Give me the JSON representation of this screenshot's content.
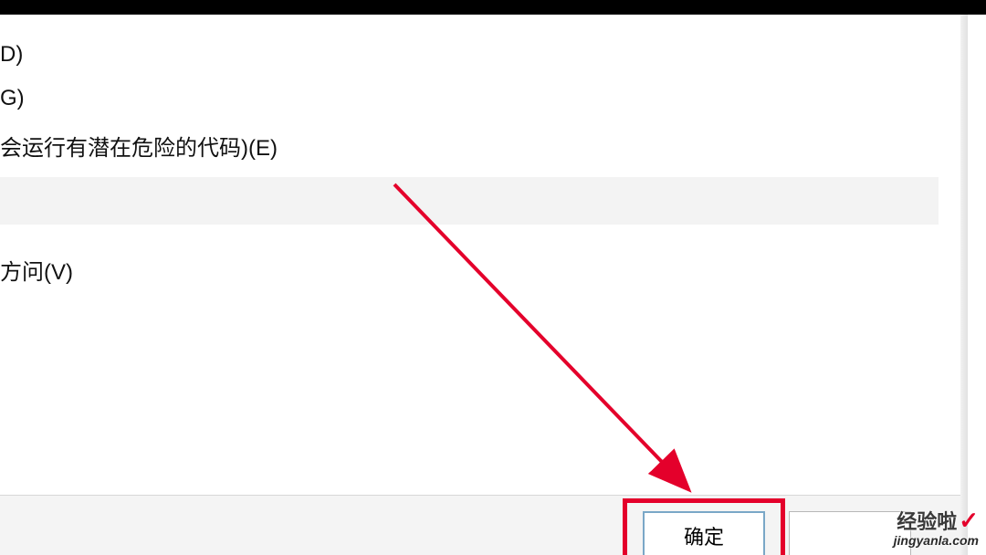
{
  "options": {
    "opt1": "D)",
    "opt2": "G)",
    "opt3": "会运行有潜在危险的代码)(E)",
    "opt4": "方问(V)"
  },
  "buttons": {
    "ok": "确定",
    "cancel": ""
  },
  "watermark": {
    "line1": "经验啦",
    "check": "✓",
    "line2": "jingyanla.com"
  }
}
